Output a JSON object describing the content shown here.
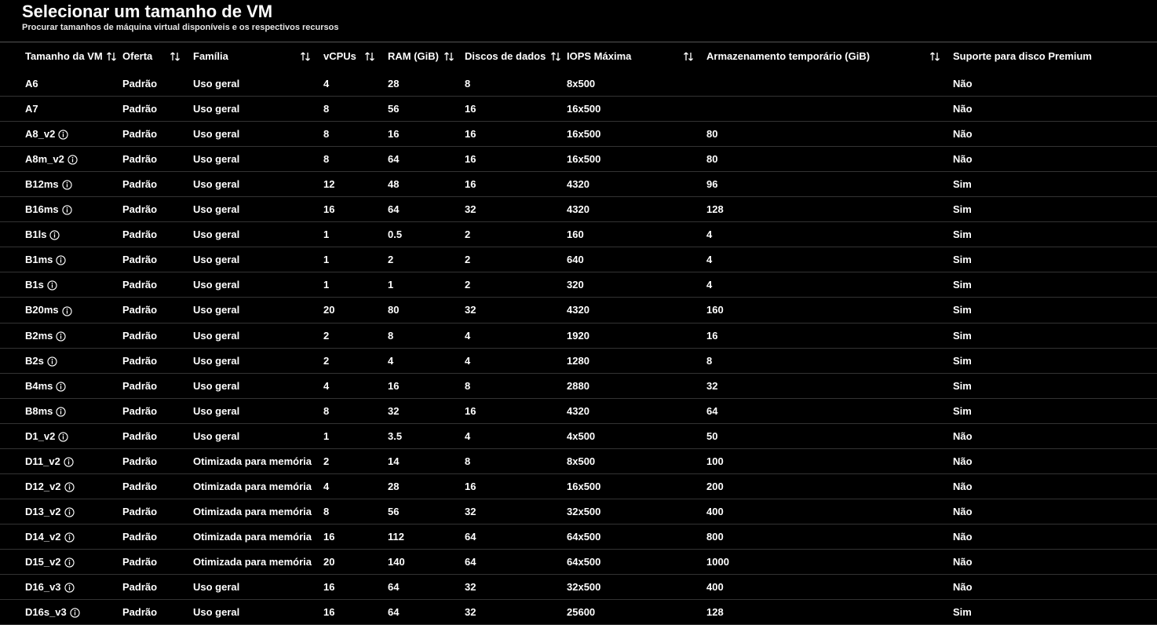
{
  "header": {
    "title": "Selecionar um tamanho de VM",
    "subtitle": "Procurar tamanhos de máquina virtual disponíveis e os respectivos recursos"
  },
  "columns": {
    "size": "Tamanho da VM",
    "offer": "Oferta",
    "family": "Família",
    "vcpus": "vCPUs",
    "ram": "RAM (GiB)",
    "disks": "Discos de dados",
    "iops": "IOPS Máxima",
    "temp": "Armazenamento temporário (GiB)",
    "prem": "Suporte para disco Premium"
  },
  "rows": [
    {
      "size": "A6",
      "info": false,
      "offer": "Padrão",
      "family": "Uso geral",
      "vcpus": "4",
      "ram": "28",
      "disks": "8",
      "iops": "8x500",
      "temp": "",
      "prem": "Não"
    },
    {
      "size": "A7",
      "info": false,
      "offer": "Padrão",
      "family": "Uso geral",
      "vcpus": "8",
      "ram": "56",
      "disks": "16",
      "iops": "16x500",
      "temp": "",
      "prem": "Não"
    },
    {
      "size": "A8_v2",
      "info": true,
      "offer": "Padrão",
      "family": "Uso geral",
      "vcpus": "8",
      "ram": "16",
      "disks": "16",
      "iops": "16x500",
      "temp": "80",
      "prem": "Não"
    },
    {
      "size": "A8m_v2",
      "info": true,
      "offer": "Padrão",
      "family": "Uso geral",
      "vcpus": "8",
      "ram": "64",
      "disks": "16",
      "iops": "16x500",
      "temp": "80",
      "prem": "Não"
    },
    {
      "size": "B12ms",
      "info": true,
      "offer": "Padrão",
      "family": "Uso geral",
      "vcpus": "12",
      "ram": "48",
      "disks": "16",
      "iops": "4320",
      "temp": "96",
      "prem": "Sim"
    },
    {
      "size": "B16ms",
      "info": true,
      "offer": "Padrão",
      "family": "Uso geral",
      "vcpus": "16",
      "ram": "64",
      "disks": "32",
      "iops": "4320",
      "temp": "128",
      "prem": "Sim"
    },
    {
      "size": "B1ls",
      "info": true,
      "offer": "Padrão",
      "family": "Uso geral",
      "vcpus": "1",
      "ram": "0.5",
      "disks": "2",
      "iops": "160",
      "temp": "4",
      "prem": "Sim"
    },
    {
      "size": "B1ms",
      "info": true,
      "offer": "Padrão",
      "family": "Uso geral",
      "vcpus": "1",
      "ram": "2",
      "disks": "2",
      "iops": "640",
      "temp": "4",
      "prem": "Sim"
    },
    {
      "size": "B1s",
      "info": true,
      "offer": "Padrão",
      "family": "Uso geral",
      "vcpus": "1",
      "ram": "1",
      "disks": "2",
      "iops": "320",
      "temp": "4",
      "prem": "Sim"
    },
    {
      "size": "B20ms",
      "info": true,
      "offer": "Padrão",
      "family": "Uso geral",
      "vcpus": "20",
      "ram": "80",
      "disks": "32",
      "iops": "4320",
      "temp": "160",
      "prem": "Sim"
    },
    {
      "size": "B2ms",
      "info": true,
      "offer": "Padrão",
      "family": "Uso geral",
      "vcpus": "2",
      "ram": "8",
      "disks": "4",
      "iops": "1920",
      "temp": "16",
      "prem": "Sim"
    },
    {
      "size": "B2s",
      "info": true,
      "offer": "Padrão",
      "family": "Uso geral",
      "vcpus": "2",
      "ram": "4",
      "disks": "4",
      "iops": "1280",
      "temp": "8",
      "prem": "Sim"
    },
    {
      "size": "B4ms",
      "info": true,
      "offer": "Padrão",
      "family": "Uso geral",
      "vcpus": "4",
      "ram": "16",
      "disks": "8",
      "iops": "2880",
      "temp": "32",
      "prem": "Sim"
    },
    {
      "size": "B8ms",
      "info": true,
      "offer": "Padrão",
      "family": "Uso geral",
      "vcpus": "8",
      "ram": "32",
      "disks": "16",
      "iops": "4320",
      "temp": "64",
      "prem": "Sim"
    },
    {
      "size": "D1_v2",
      "info": true,
      "offer": "Padrão",
      "family": "Uso geral",
      "vcpus": "1",
      "ram": "3.5",
      "disks": "4",
      "iops": "4x500",
      "temp": "50",
      "prem": "Não"
    },
    {
      "size": "D11_v2",
      "info": true,
      "offer": "Padrão",
      "family": "Otimizada para memória",
      "vcpus": "2",
      "ram": "14",
      "disks": "8",
      "iops": "8x500",
      "temp": "100",
      "prem": "Não"
    },
    {
      "size": "D12_v2",
      "info": true,
      "offer": "Padrão",
      "family": "Otimizada para memória",
      "vcpus": "4",
      "ram": "28",
      "disks": "16",
      "iops": "16x500",
      "temp": "200",
      "prem": "Não"
    },
    {
      "size": "D13_v2",
      "info": true,
      "offer": "Padrão",
      "family": "Otimizada para memória",
      "vcpus": "8",
      "ram": "56",
      "disks": "32",
      "iops": "32x500",
      "temp": "400",
      "prem": "Não"
    },
    {
      "size": "D14_v2",
      "info": true,
      "offer": "Padrão",
      "family": "Otimizada para memória",
      "vcpus": "16",
      "ram": "112",
      "disks": "64",
      "iops": "64x500",
      "temp": "800",
      "prem": "Não"
    },
    {
      "size": "D15_v2",
      "info": true,
      "offer": "Padrão",
      "family": "Otimizada para memória",
      "vcpus": "20",
      "ram": "140",
      "disks": "64",
      "iops": "64x500",
      "temp": "1000",
      "prem": "Não"
    },
    {
      "size": "D16_v3",
      "info": true,
      "offer": "Padrão",
      "family": "Uso geral",
      "vcpus": "16",
      "ram": "64",
      "disks": "32",
      "iops": "32x500",
      "temp": "400",
      "prem": "Não"
    },
    {
      "size": "D16s_v3",
      "info": true,
      "offer": "Padrão",
      "family": "Uso geral",
      "vcpus": "16",
      "ram": "64",
      "disks": "32",
      "iops": "25600",
      "temp": "128",
      "prem": "Sim"
    }
  ]
}
